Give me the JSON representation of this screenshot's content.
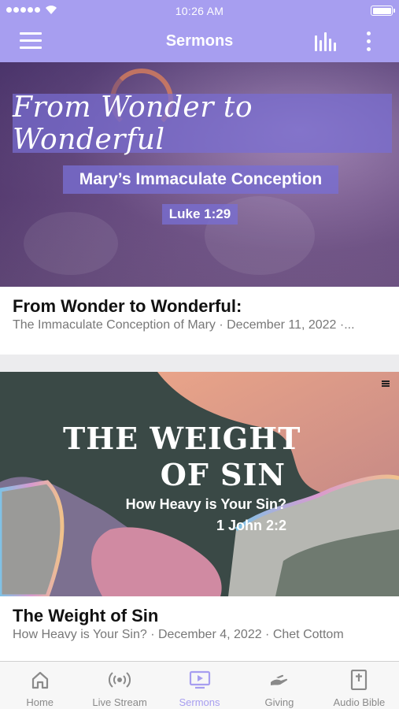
{
  "status_bar": {
    "time": "10:26 AM"
  },
  "header": {
    "title": "Sermons"
  },
  "sermons": [
    {
      "artwork": {
        "title": "From Wonder to Wonderful",
        "subtitle": "Mary’s Immaculate Conception",
        "reference": "Luke 1:29"
      },
      "title": "From Wonder to Wonderful:",
      "subtitle": "The Immaculate Conception of Mary · December 11, 2022 ·..."
    },
    {
      "artwork": {
        "title_line1": "THE WEIGHT",
        "title_line2": "OF SIN",
        "subtitle": "How Heavy is Your Sin?",
        "reference": "1 John 2:2"
      },
      "title": "The Weight of Sin",
      "subtitle": "How Heavy is Your Sin? · December 4, 2022 · Chet Cottom"
    }
  ],
  "tabs": [
    {
      "label": "Home",
      "icon": "home-icon",
      "active": false
    },
    {
      "label": "Live Stream",
      "icon": "broadcast-icon",
      "active": false
    },
    {
      "label": "Sermons",
      "icon": "tv-play-icon",
      "active": true
    },
    {
      "label": "Giving",
      "icon": "giving-hand-icon",
      "active": false
    },
    {
      "label": "Audio Bible",
      "icon": "bible-icon",
      "active": false
    }
  ],
  "colors": {
    "accent": "#a79ef0",
    "tab_inactive": "#8a8a8a"
  }
}
